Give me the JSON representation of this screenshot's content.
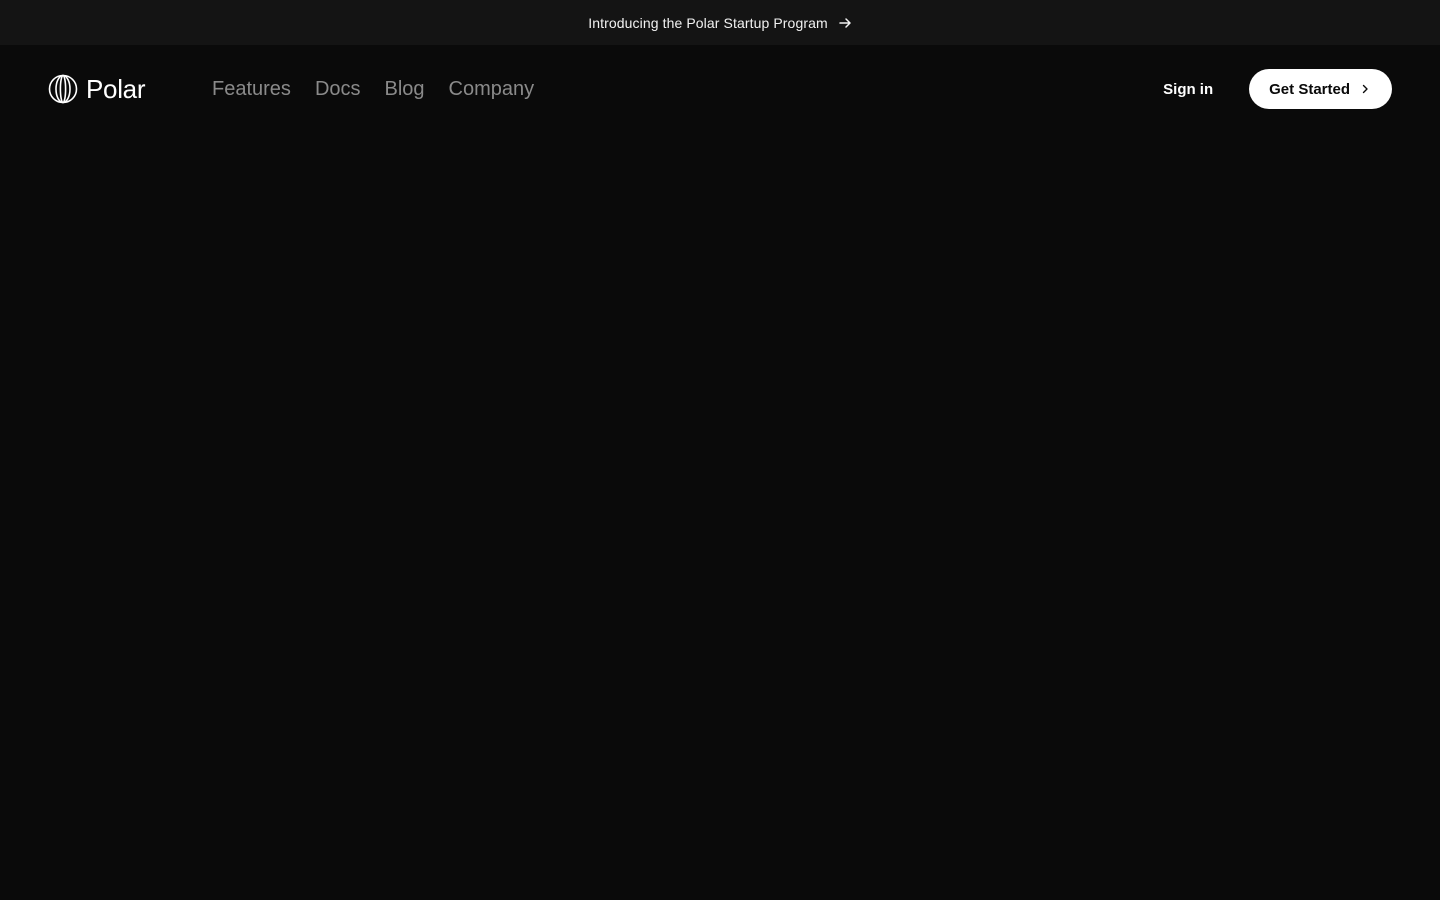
{
  "announcement": {
    "text": "Introducing the Polar Startup Program",
    "icon": "arrow-right-icon"
  },
  "header": {
    "brand": {
      "name": "Polar",
      "icon": "polar-logo-icon"
    },
    "nav": [
      {
        "label": "Features"
      },
      {
        "label": "Docs"
      },
      {
        "label": "Blog"
      },
      {
        "label": "Company"
      }
    ],
    "sign_in_label": "Sign in",
    "cta": {
      "label": "Get Started",
      "icon": "chevron-right-icon"
    }
  },
  "colors": {
    "background": "#0a0a0a",
    "announcement_bg": "#141414",
    "nav_text": "#8a8a8a",
    "cta_bg": "#ffffff",
    "cta_text": "#0a0a0a"
  }
}
